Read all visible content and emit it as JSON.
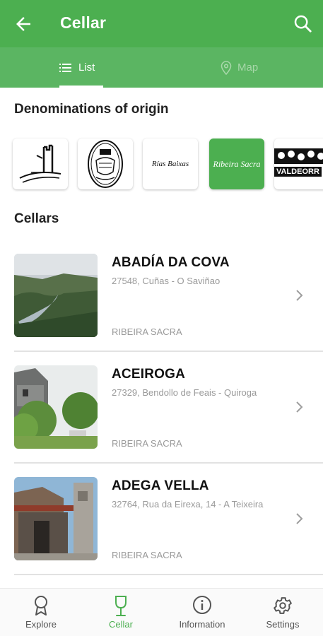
{
  "appbar": {
    "title": "Cellar",
    "back_icon": "arrow-left-icon",
    "search_icon": "search-icon",
    "color": "#4caf50"
  },
  "tabs": [
    {
      "label": "List",
      "icon": "list-icon",
      "active": true
    },
    {
      "label": "Map",
      "icon": "map-pin-icon",
      "active": false
    }
  ],
  "denominations": {
    "title": "Denominations of origin",
    "logos": [
      {
        "name": "tower-drawing-logo"
      },
      {
        "name": "crest-seal-logo"
      },
      {
        "name": "rias-baixas-logo",
        "text": "Rías Baixas"
      },
      {
        "name": "ribeira-sacra-logo",
        "text": "Ribeira Sacra",
        "selected": true
      },
      {
        "name": "valdeorras-logo",
        "text": "VALDEORR"
      }
    ]
  },
  "cellars": {
    "title": "Cellars",
    "items": [
      {
        "name": "ABADÍA DA COVA",
        "address": "27548, Cuñas - O Saviñao",
        "denomination": "RIBEIRA SACRA"
      },
      {
        "name": "ACEIROGA",
        "address": "27329, Bendollo de Feais - Quiroga",
        "denomination": "RIBEIRA SACRA"
      },
      {
        "name": "ADEGA VELLA",
        "address": "32764, Rua da Eirexa, 14 - A Teixeira",
        "denomination": "RIBEIRA SACRA"
      }
    ]
  },
  "bottom_nav": [
    {
      "label": "Explore",
      "icon": "award-ribbon-icon",
      "active": false
    },
    {
      "label": "Cellar",
      "icon": "wine-glass-icon",
      "active": true
    },
    {
      "label": "Information",
      "icon": "info-icon",
      "active": false
    },
    {
      "label": "Settings",
      "icon": "gear-icon",
      "active": false
    }
  ]
}
